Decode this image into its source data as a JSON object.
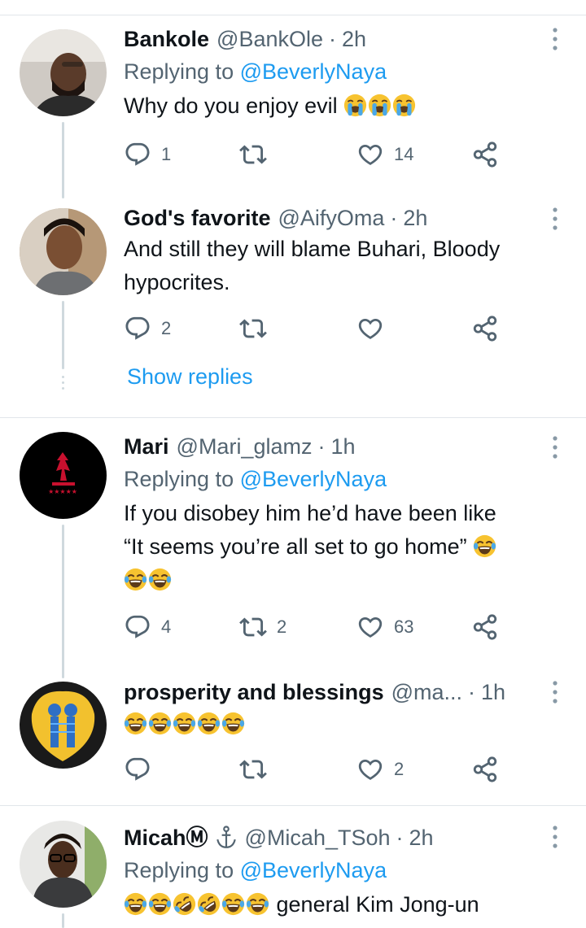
{
  "tweets": [
    {
      "name": "Bankole",
      "handle": "@BankOle",
      "time": "2h",
      "replying_label": "Replying to",
      "replying_to": "@BeverlyNaya",
      "text": "Why do you enjoy evil",
      "emojis": [
        "loudly-crying-face",
        "loudly-crying-face",
        "loudly-crying-face"
      ],
      "replies": "1",
      "retweets": "",
      "likes": "14"
    },
    {
      "name": "God's favorite",
      "handle": "@AifyOma",
      "time": "2h",
      "text_line1": "And still they will blame Buhari, Bloody",
      "text_line2": "hypocrites.",
      "replies": "2",
      "retweets": "",
      "likes": ""
    },
    {
      "name": "Mari",
      "handle": "@Mari_glamz",
      "time": "1h",
      "replying_label": "Replying to",
      "replying_to": "@BeverlyNaya",
      "text_line1": "If you disobey him he’d have been like",
      "text_line2": "“It seems you’re all set to go home”",
      "emojis": [
        "face-with-tears-of-joy",
        "face-with-tears-of-joy",
        "face-with-tears-of-joy"
      ],
      "replies": "4",
      "retweets": "2",
      "likes": "63"
    },
    {
      "name": "prosperity and blessings",
      "handle": "@ma...",
      "time": "1h",
      "emojis": [
        "face-with-tears-of-joy",
        "face-with-tears-of-joy",
        "face-with-tears-of-joy",
        "face-with-tears-of-joy",
        "face-with-tears-of-joy"
      ],
      "replies": "",
      "retweets": "",
      "likes": "2"
    },
    {
      "name": "MicahⓂ",
      "handle": "@Micah_TSoh",
      "time": "2h",
      "replying_label": "Replying to",
      "replying_to": "@BeverlyNaya",
      "emojis": [
        "face-with-tears-of-joy",
        "face-with-tears-of-joy",
        "rolling-on-floor-laughing",
        "rolling-on-floor-laughing",
        "face-with-tears-of-joy",
        "face-with-tears-of-joy"
      ],
      "text_after": "general Kim Jong-un"
    }
  ],
  "thread": {
    "show_replies": "Show replies"
  },
  "separator": "·",
  "colors": {
    "accent": "#1d9bf0",
    "secondary": "#536471",
    "border": "#e1e6ea",
    "emoji_yellow": "#f7c330"
  }
}
